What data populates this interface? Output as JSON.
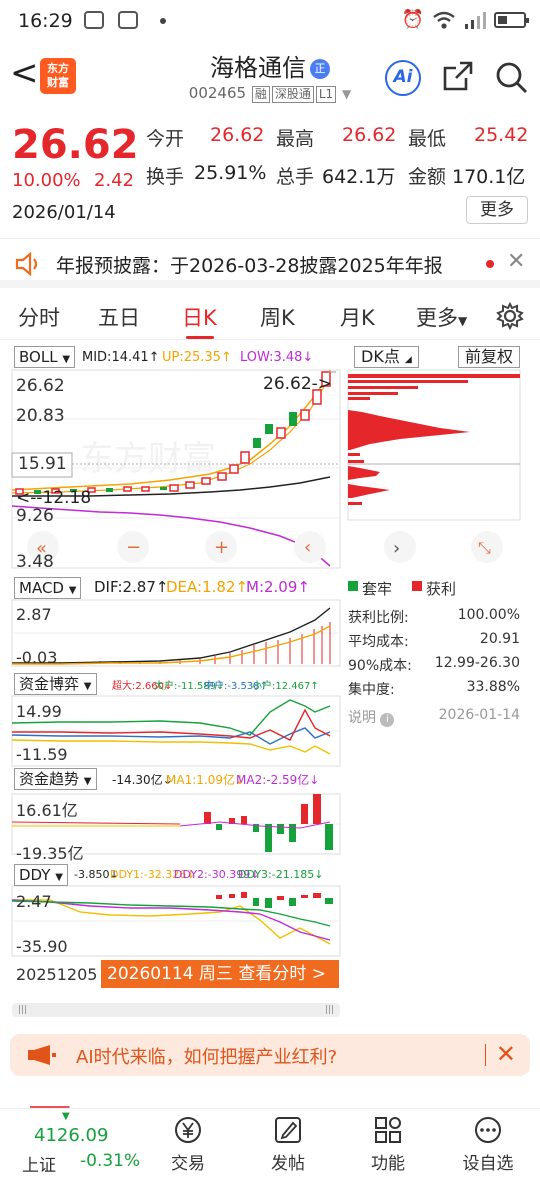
{
  "status_bar": {
    "time": "16:29"
  },
  "header": {
    "stock_name": "海格通信",
    "name_badge": "正",
    "stock_code": "002465",
    "code_tags": [
      "融",
      "深股通",
      "L1"
    ],
    "logo_text": "东方财富"
  },
  "quote": {
    "price": "26.62",
    "change_pct": "10.00%",
    "change": "2.42",
    "date": "2026/01/14",
    "open_label": "今开",
    "open": "26.62",
    "high_label": "最高",
    "high": "26.62",
    "low_label": "最低",
    "low": "25.42",
    "turnover_label": "换手",
    "turnover": "25.91%",
    "volume_label": "总手",
    "volume": "642.1万",
    "amount_label": "金额",
    "amount": "170.1亿",
    "more_label": "更多"
  },
  "notice": {
    "text": "年报预披露：于2026-03-28披露2025年年报"
  },
  "tabs": [
    "分时",
    "五日",
    "日K",
    "周K",
    "月K",
    "更多"
  ],
  "active_tab": "日K",
  "main_chart": {
    "indicator": "BOLL",
    "mid": "MID:14.41↑",
    "up": "UP:25.35↑",
    "low": "LOW:3.48↓",
    "y_labels": [
      "26.62",
      "20.83",
      "15.91",
      "9.26",
      "3.48"
    ],
    "last_price_label": "26.62->",
    "low_mark_label": "<--12.18"
  },
  "macd": {
    "name": "MACD",
    "dif": "DIF:2.87↑",
    "dea": "DEA:1.82↑",
    "m": "M:2.09↑",
    "y_top": "2.87",
    "y_bottom": "-0.03"
  },
  "capital_game": {
    "name": "资金博弈",
    "super": "超大:2.660↓",
    "large": "大户:-11.589↓",
    "mid": "中户:-3.538↑",
    "small": "小户:12.467↑",
    "y_top": "14.99",
    "y_bottom": "-11.59"
  },
  "capital_trend": {
    "name": "资金趋势",
    "value": "-14.30亿↓",
    "ma1": "MA1:1.09亿↓",
    "ma2": "MA2:-2.59亿↓",
    "y_top": "16.61亿",
    "y_bottom": "-19.35亿"
  },
  "ddy": {
    "name": "DDY",
    "value": "-3.850↓",
    "ddy1": "DDY1:-32.326↓",
    "ddy2": "DDY2:-30.399↓",
    "ddy3": "DDY3:-21.185↓",
    "y_top": "2.47",
    "y_bottom": "-35.90"
  },
  "dk_panel": {
    "dk_label": "DK点",
    "fq_label": "前复权",
    "legend_trap": "套牢",
    "legend_profit": "获利",
    "stats": [
      {
        "label": "获利比例:",
        "value": "100.00%"
      },
      {
        "label": "平均成本:",
        "value": "20.91"
      },
      {
        "label": "90%成本:",
        "value": "12.99-26.30"
      },
      {
        "label": "集中度:",
        "value": "33.88%"
      }
    ],
    "explain_label": "说明",
    "explain_date": "2026-01-14"
  },
  "bottom": {
    "start_date": "20251205",
    "detail_label": "20260114 周三 查看分时 >"
  },
  "ad": {
    "text": "AI时代来临，如何把握产业红利?"
  },
  "index": {
    "value": "4126.09",
    "name": "上证",
    "pct": "-0.31%"
  },
  "nav": [
    "交易",
    "发帖",
    "功能",
    "设自选"
  ],
  "colors": {
    "red": "#e5262b",
    "green": "#16a23b",
    "orange": "#f06a1f",
    "boll_mid": "#f5a300",
    "boll_up": "#f5a300",
    "boll_low": "#c02bd6"
  }
}
